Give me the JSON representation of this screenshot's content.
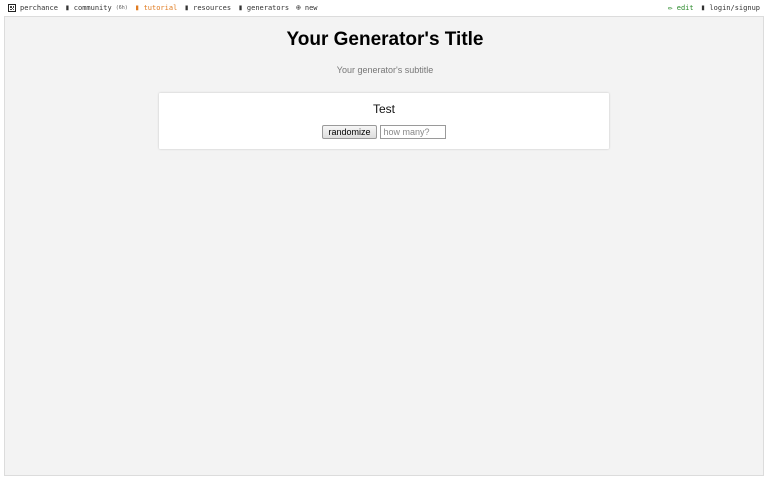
{
  "nav": {
    "items": [
      {
        "icon": "dice-icon",
        "label": "perchance"
      },
      {
        "icon": "chat-icon",
        "label": "community",
        "badge": "(6h)"
      },
      {
        "icon": "book-icon",
        "label": "tutorial"
      },
      {
        "icon": "folder-icon",
        "label": "resources"
      },
      {
        "icon": "grid-icon",
        "label": "generators"
      },
      {
        "icon": "plus-circle-icon",
        "label": "new"
      }
    ],
    "right": [
      {
        "icon": "pencil-icon",
        "label": "edit"
      },
      {
        "icon": "user-icon",
        "label": "login/signup"
      }
    ]
  },
  "generator": {
    "title": "Your Generator's Title",
    "subtitle": "Your generator's subtitle",
    "output": "Test",
    "randomize_label": "randomize",
    "count_placeholder": "how many?"
  },
  "colors": {
    "active_nav": "#e07b20",
    "edit": "#2a8a2a",
    "frame_bg": "#f3f3f3"
  }
}
